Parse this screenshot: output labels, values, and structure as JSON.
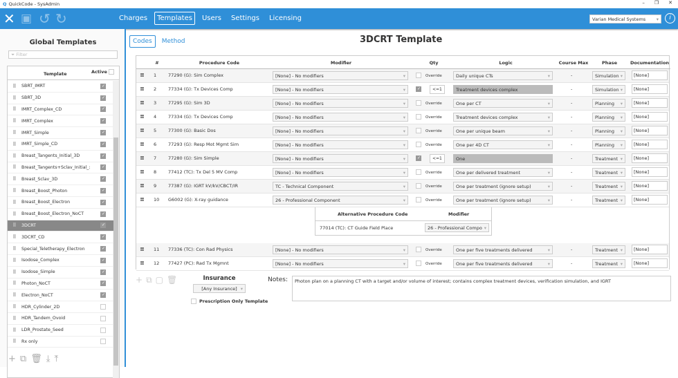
{
  "window": {
    "title": "QuickCode - SysAdmin",
    "minimize": "–",
    "restore": "❐",
    "close": "✕"
  },
  "nav": {
    "items": [
      "Charges",
      "Templates",
      "Users",
      "Settings",
      "Licensing"
    ],
    "active": "Templates",
    "organization": "Varian Medical Systems",
    "info": "i"
  },
  "sidebar": {
    "title": "Global Templates",
    "filter_placeholder": "Filter",
    "col_template": "Template",
    "col_active": "Active",
    "selected": "3DCRT",
    "items": [
      {
        "name": "SBRT_IMRT",
        "active": true
      },
      {
        "name": "SBRT_3D",
        "active": true
      },
      {
        "name": "IMRT_Complex_CD",
        "active": true
      },
      {
        "name": "IMRT_Complex",
        "active": true
      },
      {
        "name": "IMRT_Simple",
        "active": true
      },
      {
        "name": "IMRT_Simple_CD",
        "active": true
      },
      {
        "name": "Breast_Tangents_Initial_3D",
        "active": true
      },
      {
        "name": "Breast_Tangents+Sclav_Initial_:",
        "active": true
      },
      {
        "name": "Breast_Sclav_3D",
        "active": true
      },
      {
        "name": "Breast_Boost_Photon",
        "active": true
      },
      {
        "name": "Breast_Boost_Electron",
        "active": true
      },
      {
        "name": "Breast_Boost_Electron_NoCT",
        "active": true
      },
      {
        "name": "3DCRT",
        "active": true
      },
      {
        "name": "3DCRT_CD",
        "active": true
      },
      {
        "name": "Special_Teletherapy_Electron",
        "active": true
      },
      {
        "name": "Isodose_Complex",
        "active": true
      },
      {
        "name": "Isodose_Simple",
        "active": true
      },
      {
        "name": "Photon_NoCT",
        "active": true
      },
      {
        "name": "Electron_NoCT",
        "active": true
      },
      {
        "name": "HDR_Cylinder_2D",
        "active": false
      },
      {
        "name": "HDR_Tandem_Ovoid",
        "active": false
      },
      {
        "name": "LDR_Prostate_Seed",
        "active": false
      },
      {
        "name": "Rx only",
        "active": false
      }
    ]
  },
  "main": {
    "tabs": [
      "Codes",
      "Method"
    ],
    "active_tab": "Codes",
    "title": "3DCRT Template",
    "columns": [
      "#",
      "Procedure Code",
      "Modifier",
      "Qty",
      "Logic",
      "Course Max",
      "Phase",
      "Documentation"
    ],
    "rows": [
      {
        "n": "1",
        "code": "77290 (G): Sim Complex",
        "modifier": "[None] - No modifiers",
        "qty_checked": false,
        "qty": "Override",
        "logic": "Daily unique CTs",
        "course_max": "-",
        "phase": "Simulation",
        "doc": "[None]"
      },
      {
        "n": "2",
        "code": "77334 (G): Tx Devices Comp",
        "modifier": "[None] - No modifiers",
        "qty_checked": true,
        "qty": "<=1",
        "logic": "Treatment devices complex",
        "course_max": "-",
        "phase": "Simulation",
        "doc": "[None]"
      },
      {
        "n": "3",
        "code": "77295 (G): Sim 3D",
        "modifier": "[None] - No modifiers",
        "qty_checked": false,
        "qty": "Override",
        "logic": "One per CT",
        "course_max": "-",
        "phase": "Planning",
        "doc": "[None]"
      },
      {
        "n": "4",
        "code": "77334 (G): Tx Devices Comp",
        "modifier": "[None] - No modifiers",
        "qty_checked": false,
        "qty": "Override",
        "logic": "Treatment devices complex",
        "course_max": "-",
        "phase": "Planning",
        "doc": "[None]"
      },
      {
        "n": "5",
        "code": "77300 (G): Basic Dos",
        "modifier": "[None] - No modifiers",
        "qty_checked": false,
        "qty": "Override",
        "logic": "One per unique beam",
        "course_max": "-",
        "phase": "Planning",
        "doc": "[None]"
      },
      {
        "n": "6",
        "code": "77293 (G): Resp Mot Mgmt Sim",
        "modifier": "[None] - No modifiers",
        "qty_checked": false,
        "qty": "Override",
        "logic": "One per 4D CT",
        "course_max": "-",
        "phase": "Planning",
        "doc": "[None]"
      },
      {
        "n": "7",
        "code": "77280 (G): Sim Simple",
        "modifier": "[None] - No modifiers",
        "qty_checked": true,
        "qty": "<=1",
        "logic": "One",
        "course_max": "-",
        "phase": "Treatment",
        "doc": "[None]"
      },
      {
        "n": "8",
        "code": "77412 (TC): Tx Del 5 MV Comp",
        "modifier": "[None] - No modifiers",
        "qty_checked": false,
        "qty": "Override",
        "logic": "One per delivered treatment",
        "course_max": "-",
        "phase": "Treatment",
        "doc": "[None]"
      },
      {
        "n": "9",
        "code": "77387 (G): IGRT kV/kV/CBCT/IR",
        "modifier": "TC - Technical Component",
        "qty_checked": false,
        "qty": "Override",
        "logic": "One per treatment (ignore setup)",
        "course_max": "-",
        "phase": "Treatment",
        "doc": "[None]"
      },
      {
        "n": "10",
        "code": "G6002 (G): X-ray guidance",
        "modifier": "26 - Professional Component",
        "qty_checked": false,
        "qty": "Override",
        "logic": "One per treatment (ignore setup)",
        "course_max": "-",
        "phase": "Treatment",
        "doc": "[None]"
      },
      {
        "n": "11",
        "code": "77336 (TC): Con Rad Physics",
        "modifier": "[None] - No modifiers",
        "qty_checked": false,
        "qty": "Override",
        "logic": "One per five treatments delivered",
        "course_max": "-",
        "phase": "Treatment",
        "doc": "[None]"
      },
      {
        "n": "12",
        "code": "77427 (PC): Rad Tx Mgmnt",
        "modifier": "[None] - No modifiers",
        "qty_checked": false,
        "qty": "Override",
        "logic": "One per five treatments delivered",
        "course_max": "-",
        "phase": "Treatment",
        "doc": "[None]"
      }
    ],
    "alternative": {
      "col_code": "Alternative Procedure Code",
      "col_modifier": "Modifier",
      "code": "77014 (TC): CT Guide Field Place",
      "modifier": "26 - Professional Compo"
    },
    "insurance_label": "Insurance",
    "insurance_value": "[Any Insurance]",
    "rx_only_label": "Prescription Only Template",
    "notes_label": "Notes:",
    "notes": "Photon plan on a planning CT with a target and/or volume of interest; contains complex treatment devices, verification simulation, and IGRT"
  }
}
